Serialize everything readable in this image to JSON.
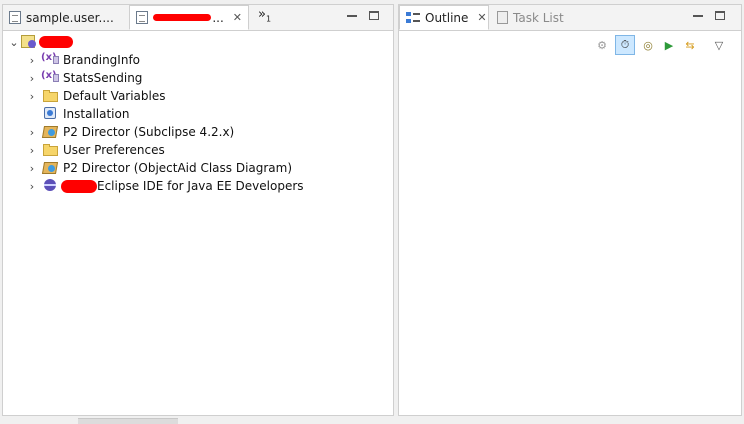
{
  "left_pane": {
    "tabs": [
      {
        "label": "sample.user...."
      },
      {
        "label": "..."
      }
    ],
    "overflow": {
      "label": "»",
      "count": "1"
    }
  },
  "tree": {
    "items": [
      {
        "label": "BrandingInfo",
        "icon": "attribute-icon"
      },
      {
        "label": "StatsSending",
        "icon": "attribute-icon"
      },
      {
        "label": "Default Variables",
        "icon": "folder-icon"
      },
      {
        "label": "Installation",
        "icon": "installation-icon"
      },
      {
        "label": "P2 Director (Subclipse 4.2.x)",
        "icon": "p2-director-icon"
      },
      {
        "label": "User Preferences",
        "icon": "folder-icon"
      },
      {
        "label": "P2 Director (ObjectAid Class Diagram)",
        "icon": "p2-director-icon"
      },
      {
        "label": "Eclipse IDE for Java EE Developers",
        "icon": "globe-icon"
      }
    ]
  },
  "right_pane": {
    "tabs": [
      {
        "label": "Outline"
      },
      {
        "label": "Task List"
      }
    ],
    "toolbar_icons": [
      "gears-icon",
      "timer-icon",
      "cd-icon",
      "run-icon",
      "sync-icon",
      "view-menu-icon"
    ]
  },
  "colors": {
    "redaction": "#ff0000",
    "active_toggle": "#cde8ff"
  }
}
